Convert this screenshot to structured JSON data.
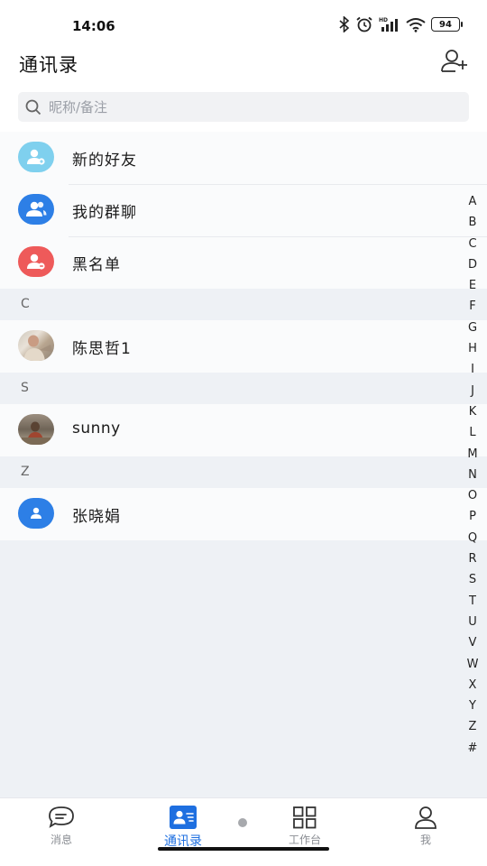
{
  "status_bar": {
    "time": "14:06",
    "battery": "94",
    "network_badge": "HD"
  },
  "header": {
    "title": "通讯录"
  },
  "search": {
    "placeholder": "昵称/备注"
  },
  "function_items": [
    {
      "label": "新的好友",
      "icon": "new-friend-icon",
      "color": "#7fd0ee"
    },
    {
      "label": "我的群聊",
      "icon": "group-chat-icon",
      "color": "#2d7fe6"
    },
    {
      "label": "黑名单",
      "icon": "blacklist-icon",
      "color": "#ee5a5a"
    }
  ],
  "sections": [
    {
      "letter": "C",
      "contacts": [
        {
          "name": "陈思哲1",
          "avatar": "photo-avatar"
        }
      ]
    },
    {
      "letter": "S",
      "contacts": [
        {
          "name": "sunny",
          "avatar": "photo-avatar"
        }
      ]
    },
    {
      "letter": "Z",
      "contacts": [
        {
          "name": "张晓娟",
          "avatar": "default-person-avatar"
        }
      ]
    }
  ],
  "alphabet_index": [
    "A",
    "B",
    "C",
    "D",
    "E",
    "F",
    "G",
    "H",
    "I",
    "J",
    "K",
    "L",
    "M",
    "N",
    "O",
    "P",
    "Q",
    "R",
    "S",
    "T",
    "U",
    "V",
    "W",
    "X",
    "Y",
    "Z",
    "#"
  ],
  "tabs": [
    {
      "label": "消息",
      "icon": "chat-bubble-icon",
      "active": false
    },
    {
      "label": "通讯录",
      "icon": "contacts-icon",
      "active": true
    },
    {
      "label": "工作台",
      "icon": "grid-icon",
      "active": false
    },
    {
      "label": "我",
      "icon": "person-icon",
      "active": false
    }
  ],
  "colors": {
    "accent": "#1e6fe0",
    "background": "#eef1f5"
  }
}
